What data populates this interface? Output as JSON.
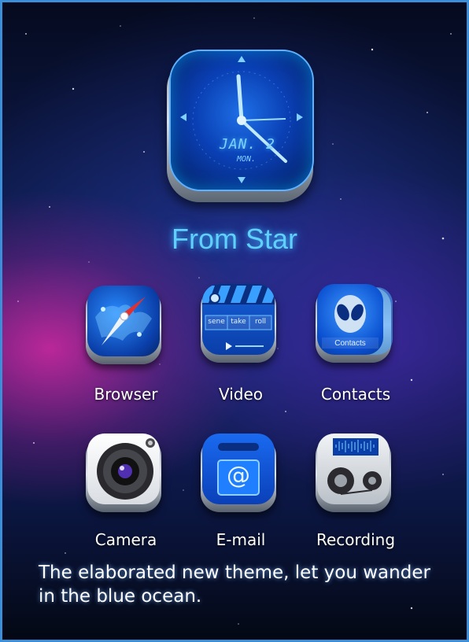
{
  "widget": {
    "date_text": "JAN. 2",
    "day_text": "MON."
  },
  "title": "From Star",
  "apps": [
    {
      "label": "Browser",
      "icon": "compass-icon"
    },
    {
      "label": "Video",
      "icon": "clapperboard-icon",
      "clapper_words": [
        "sene",
        "take",
        "roll"
      ]
    },
    {
      "label": "Contacts",
      "icon": "alien-contacts-icon",
      "badge_text": "Contacts"
    },
    {
      "label": "Camera",
      "icon": "camera-lens-icon"
    },
    {
      "label": "E-mail",
      "icon": "email-at-icon",
      "symbol": "@"
    },
    {
      "label": "Recording",
      "icon": "tape-recorder-icon"
    }
  ],
  "tagline": "The elaborated new theme, let you wander in the blue ocean.",
  "colors": {
    "accent": "#3a8fd8",
    "title_glow": "#5fd0ff",
    "icon_blue": "#0a4fd0"
  }
}
